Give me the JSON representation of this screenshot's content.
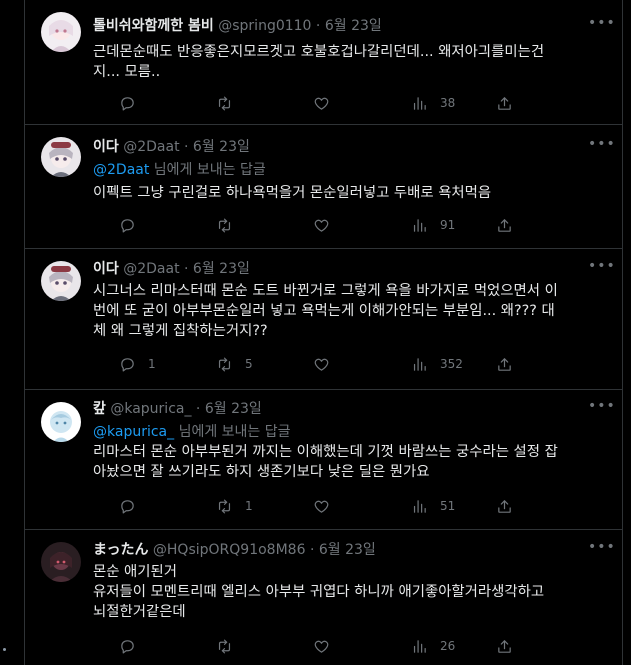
{
  "tweets": [
    {
      "name": "톨비쉬와함께한 봄비",
      "handle": "@spring0110",
      "dot": "·",
      "time": "6월 23일",
      "reply_to": null,
      "lines": [
        "근데몬순때도 반응좋은지모르겟고 호불호겁나갈리던데... 왜저아긔를미는건",
        "지... 모름.."
      ],
      "reply_count": "",
      "retweet_count": "",
      "like_count": "",
      "view_count": "38"
    },
    {
      "name": "이다",
      "handle": "@2Daat",
      "dot": "·",
      "time": "6월 23일",
      "reply_to": {
        "handle": "@2Daat",
        "suffix": " 님에게 보내는 답글"
      },
      "lines": [
        "이펙트 그냥 구린걸로 하나욕먹을거 몬순일러넣고 두배로 욕처먹음"
      ],
      "reply_count": "",
      "retweet_count": "",
      "like_count": "",
      "view_count": "91"
    },
    {
      "name": "이다",
      "handle": "@2Daat",
      "dot": "·",
      "time": "6월 23일",
      "reply_to": null,
      "lines": [
        "시그너스 리마스터때 몬순 도트 바뀐거로 그렇게 욕을 바가지로 먹었으면서 이",
        "번에 또 굳이 아부부몬순일러 넣고 욕먹는게 이해가안되는 부분임... 왜??? 대",
        "체 왜 그렇게 집착하는거지??"
      ],
      "reply_count": "1",
      "retweet_count": "5",
      "like_count": "",
      "view_count": "352"
    },
    {
      "name": "캎",
      "handle": "@kapurica_",
      "dot": "·",
      "time": "6월 23일",
      "reply_to": {
        "handle": "@kapurica_",
        "suffix": " 님에게 보내는 답글"
      },
      "lines": [
        "리마스터 몬순 아부부된거 까지는 이해했는데 기껏 바람쓰는 궁수라는 설정 잡",
        "아놨으면 잘 쓰기라도 하지 생존기보다 낮은 딜은 뭔가요"
      ],
      "reply_count": "",
      "retweet_count": "1",
      "like_count": "",
      "view_count": "51"
    },
    {
      "name": "まったん",
      "handle": "@HQsipORQ91o8M86",
      "dot": "·",
      "time": "6월 23일",
      "reply_to": null,
      "lines": [
        "몬순 애기된거",
        "유저들이 모멘트리때 엘리스 아부부 귀엽다 하니까 애기좋아할거라생각하고",
        "뇌절한거같은데"
      ],
      "reply_count": "",
      "retweet_count": "",
      "like_count": "",
      "view_count": "26"
    }
  ],
  "colors": {
    "background": "#000000",
    "text": "#e7e9ea",
    "muted": "#71767b",
    "link": "#1d9bf0",
    "divider": "#2f3336"
  },
  "icons": [
    "reply-icon",
    "retweet-icon",
    "like-icon",
    "views-icon",
    "share-icon",
    "more-icon"
  ]
}
